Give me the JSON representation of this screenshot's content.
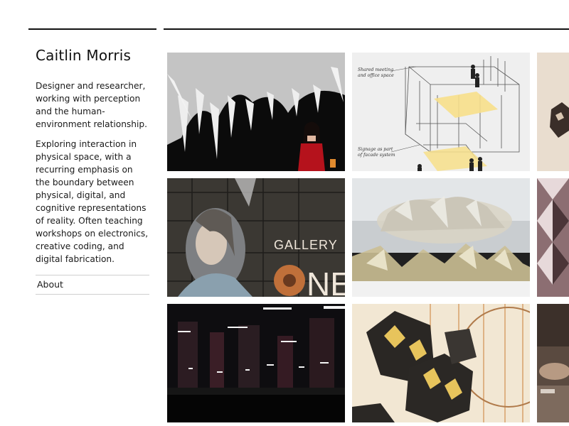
{
  "site": {
    "title": "Caitlin Morris",
    "intro": [
      "Designer and researcher, working with perception and the human-environment relationship.",
      "Exploring interaction in physical space, with a recurring emphasis on the boundary between physical, digital, and cognitive representations of reality. Often teaching workshops on electronics, creative coding, and digital fabrication."
    ]
  },
  "nav": {
    "items": [
      {
        "label": "About"
      }
    ]
  },
  "projects": {
    "tile_2": {
      "caption_1": "Shared meeting",
      "caption_2": "and office space",
      "caption_3": "Signage as part",
      "caption_4": "of facade system"
    },
    "tile_5": {
      "sign_word": "GALLERY",
      "sign_big": "NE"
    }
  }
}
